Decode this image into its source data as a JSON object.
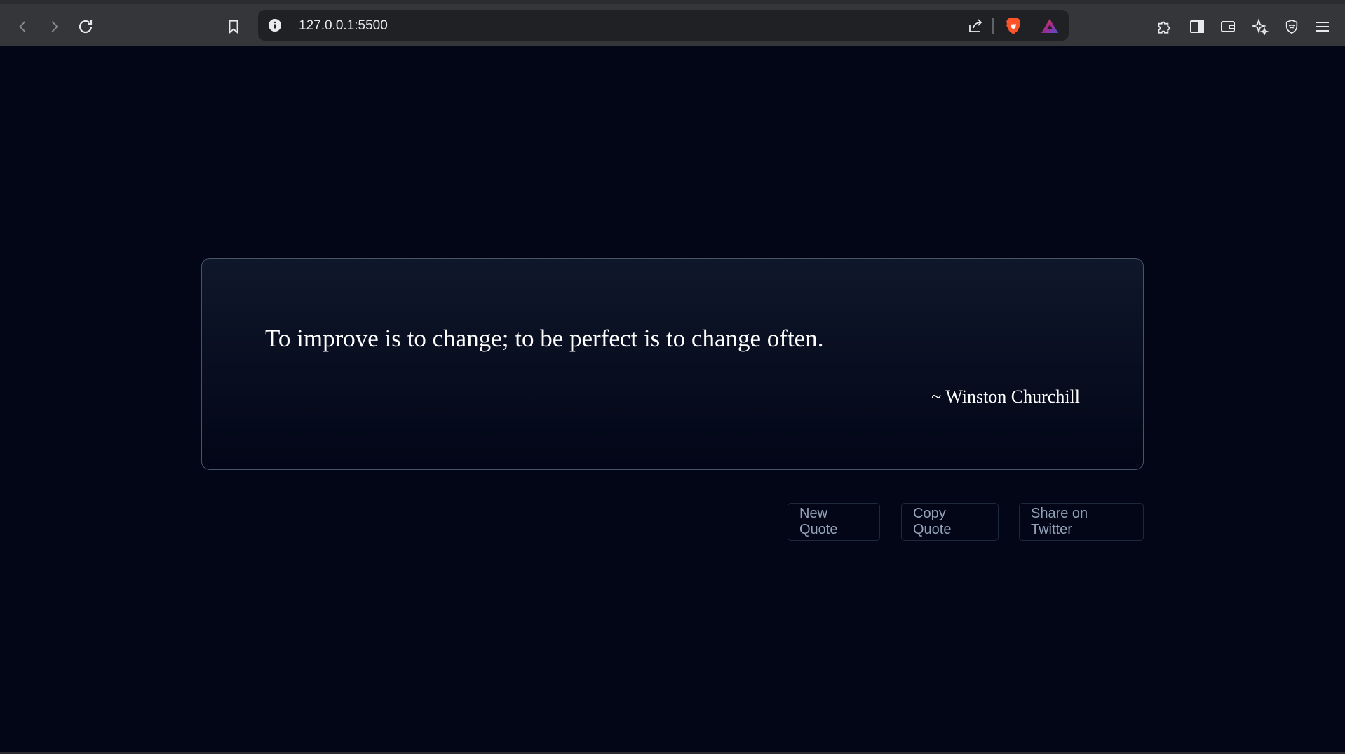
{
  "browser": {
    "url": "127.0.0.1:5500"
  },
  "quote": {
    "text": "To improve is to change; to be perfect is to change often.",
    "author": "~ Winston Churchill"
  },
  "actions": {
    "new_quote": "New Quote",
    "copy_quote": "Copy Quote",
    "share_twitter": "Share on Twitter"
  },
  "colors": {
    "page_background": "#020617",
    "card_border": "#475569",
    "button_text": "#94a3b8",
    "brave_orange": "#fb542b"
  },
  "icons": {
    "back": "chevron-left-icon",
    "forward": "chevron-right-icon",
    "reload": "reload-icon",
    "bookmark": "bookmark-icon",
    "info": "info-icon",
    "share": "share-icon",
    "brave_shields": "brave-lion-icon",
    "brave_rewards": "triangle-icon",
    "extensions": "puzzle-icon",
    "sidebar": "sidebar-icon",
    "wallet": "wallet-icon",
    "leo": "sparkle-icon",
    "vpn": "shield-icon",
    "menu": "hamburger-icon"
  }
}
